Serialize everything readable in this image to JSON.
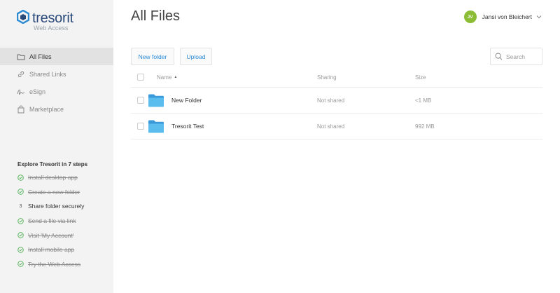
{
  "brand": {
    "name": "tresorit",
    "subtitle": "Web Access",
    "color": "#2a4a7a"
  },
  "sidebar": {
    "items": [
      {
        "label": "All Files",
        "icon": "folder-icon",
        "active": true
      },
      {
        "label": "Shared Links",
        "icon": "link-icon",
        "active": false
      },
      {
        "label": "eSign",
        "icon": "signature-icon",
        "active": false
      },
      {
        "label": "Marketplace",
        "icon": "shopping-bag-icon",
        "active": false
      }
    ],
    "explore": {
      "title": "Explore Tresorit in 7 steps",
      "steps": [
        {
          "label": "Install desktop app",
          "done": true
        },
        {
          "label": "Create a new folder",
          "done": true
        },
        {
          "label": "Share folder securely",
          "done": false,
          "number": "3"
        },
        {
          "label": "Send a file via link",
          "done": true
        },
        {
          "label": "Visit 'My Account'",
          "done": true
        },
        {
          "label": "Install mobile app",
          "done": true
        },
        {
          "label": "Try the Web Access",
          "done": true
        }
      ]
    }
  },
  "header": {
    "title": "All Files",
    "user": {
      "initials": "JV",
      "name": "Jansi von Bleichert",
      "avatar_color": "#8cbb34"
    }
  },
  "toolbar": {
    "new_folder_label": "New folder",
    "upload_label": "Upload",
    "search_placeholder": "Search"
  },
  "table": {
    "columns": {
      "name": "Name",
      "sharing": "Sharing",
      "size": "Size"
    },
    "rows": [
      {
        "name": "New Folder",
        "sharing": "Not shared",
        "size": "<1 MB"
      },
      {
        "name": "Tresorit Test",
        "sharing": "Not shared",
        "size": "992 MB"
      }
    ]
  },
  "colors": {
    "accent": "#2a8ad4",
    "check_green": "#4caf50",
    "folder_blue": "#4fb3e8"
  }
}
